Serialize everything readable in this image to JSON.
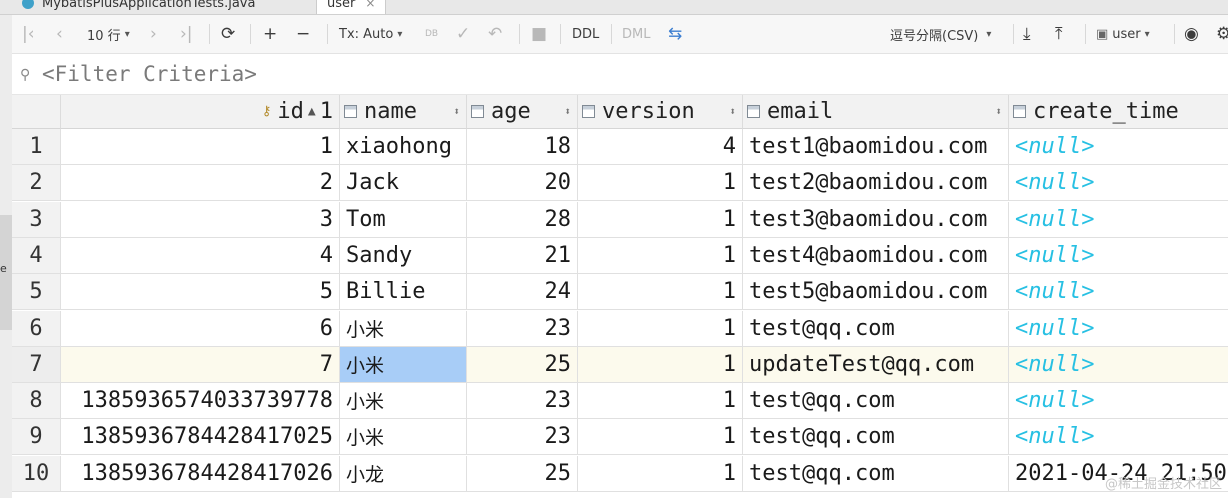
{
  "editor_tabs": [
    {
      "label": "MybatisPlusApplicationTests.java",
      "active": false
    },
    {
      "label": "user",
      "active": true
    }
  ],
  "toolbar": {
    "rows_label": "10 行",
    "tx_label": "Tx: Auto",
    "ddl_label": "DDL",
    "dml_label": "DML",
    "db_label": "DB",
    "export_format": "逗号分隔(CSV)",
    "datasource": "user"
  },
  "filter": {
    "placeholder": "<Filter Criteria>"
  },
  "left_strip_char": "e",
  "columns": [
    {
      "name": "id",
      "sort_index": "1"
    },
    {
      "name": "name"
    },
    {
      "name": "age"
    },
    {
      "name": "version"
    },
    {
      "name": "email"
    },
    {
      "name": "create_time"
    }
  ],
  "rows": [
    {
      "n": "1",
      "id": "1",
      "name": "xiaohong",
      "age": "18",
      "version": "4",
      "email": "test1@baomidou.com",
      "create_time": "<null>"
    },
    {
      "n": "2",
      "id": "2",
      "name": "Jack",
      "age": "20",
      "version": "1",
      "email": "test2@baomidou.com",
      "create_time": "<null>"
    },
    {
      "n": "3",
      "id": "3",
      "name": "Tom",
      "age": "28",
      "version": "1",
      "email": "test3@baomidou.com",
      "create_time": "<null>"
    },
    {
      "n": "4",
      "id": "4",
      "name": "Sandy",
      "age": "21",
      "version": "1",
      "email": "test4@baomidou.com",
      "create_time": "<null>"
    },
    {
      "n": "5",
      "id": "5",
      "name": "Billie",
      "age": "24",
      "version": "1",
      "email": "test5@baomidou.com",
      "create_time": "<null>"
    },
    {
      "n": "6",
      "id": "6",
      "name": "小米",
      "age": "23",
      "version": "1",
      "email": "test@qq.com",
      "create_time": "<null>"
    },
    {
      "n": "7",
      "id": "7",
      "name": "小米",
      "age": "25",
      "version": "1",
      "email": "updateTest@qq.com",
      "create_time": "<null>"
    },
    {
      "n": "8",
      "id": "1385936574033739778",
      "name": "小米",
      "age": "23",
      "version": "1",
      "email": "test@qq.com",
      "create_time": "<null>"
    },
    {
      "n": "9",
      "id": "1385936784428417025",
      "name": "小米",
      "age": "23",
      "version": "1",
      "email": "test@qq.com",
      "create_time": "<null>"
    },
    {
      "n": "10",
      "id": "1385936784428417026",
      "name": "小龙",
      "age": "25",
      "version": "1",
      "email": "test@qq.com",
      "create_time": "2021-04-24 21:50"
    }
  ],
  "selected_row": "7",
  "focused_cell": "name",
  "watermark": "@稀土掘金技术社区",
  "colors": {
    "null_text": "#27c0e3",
    "selection": "#a8cdf7",
    "accent": "#4a88d8"
  }
}
